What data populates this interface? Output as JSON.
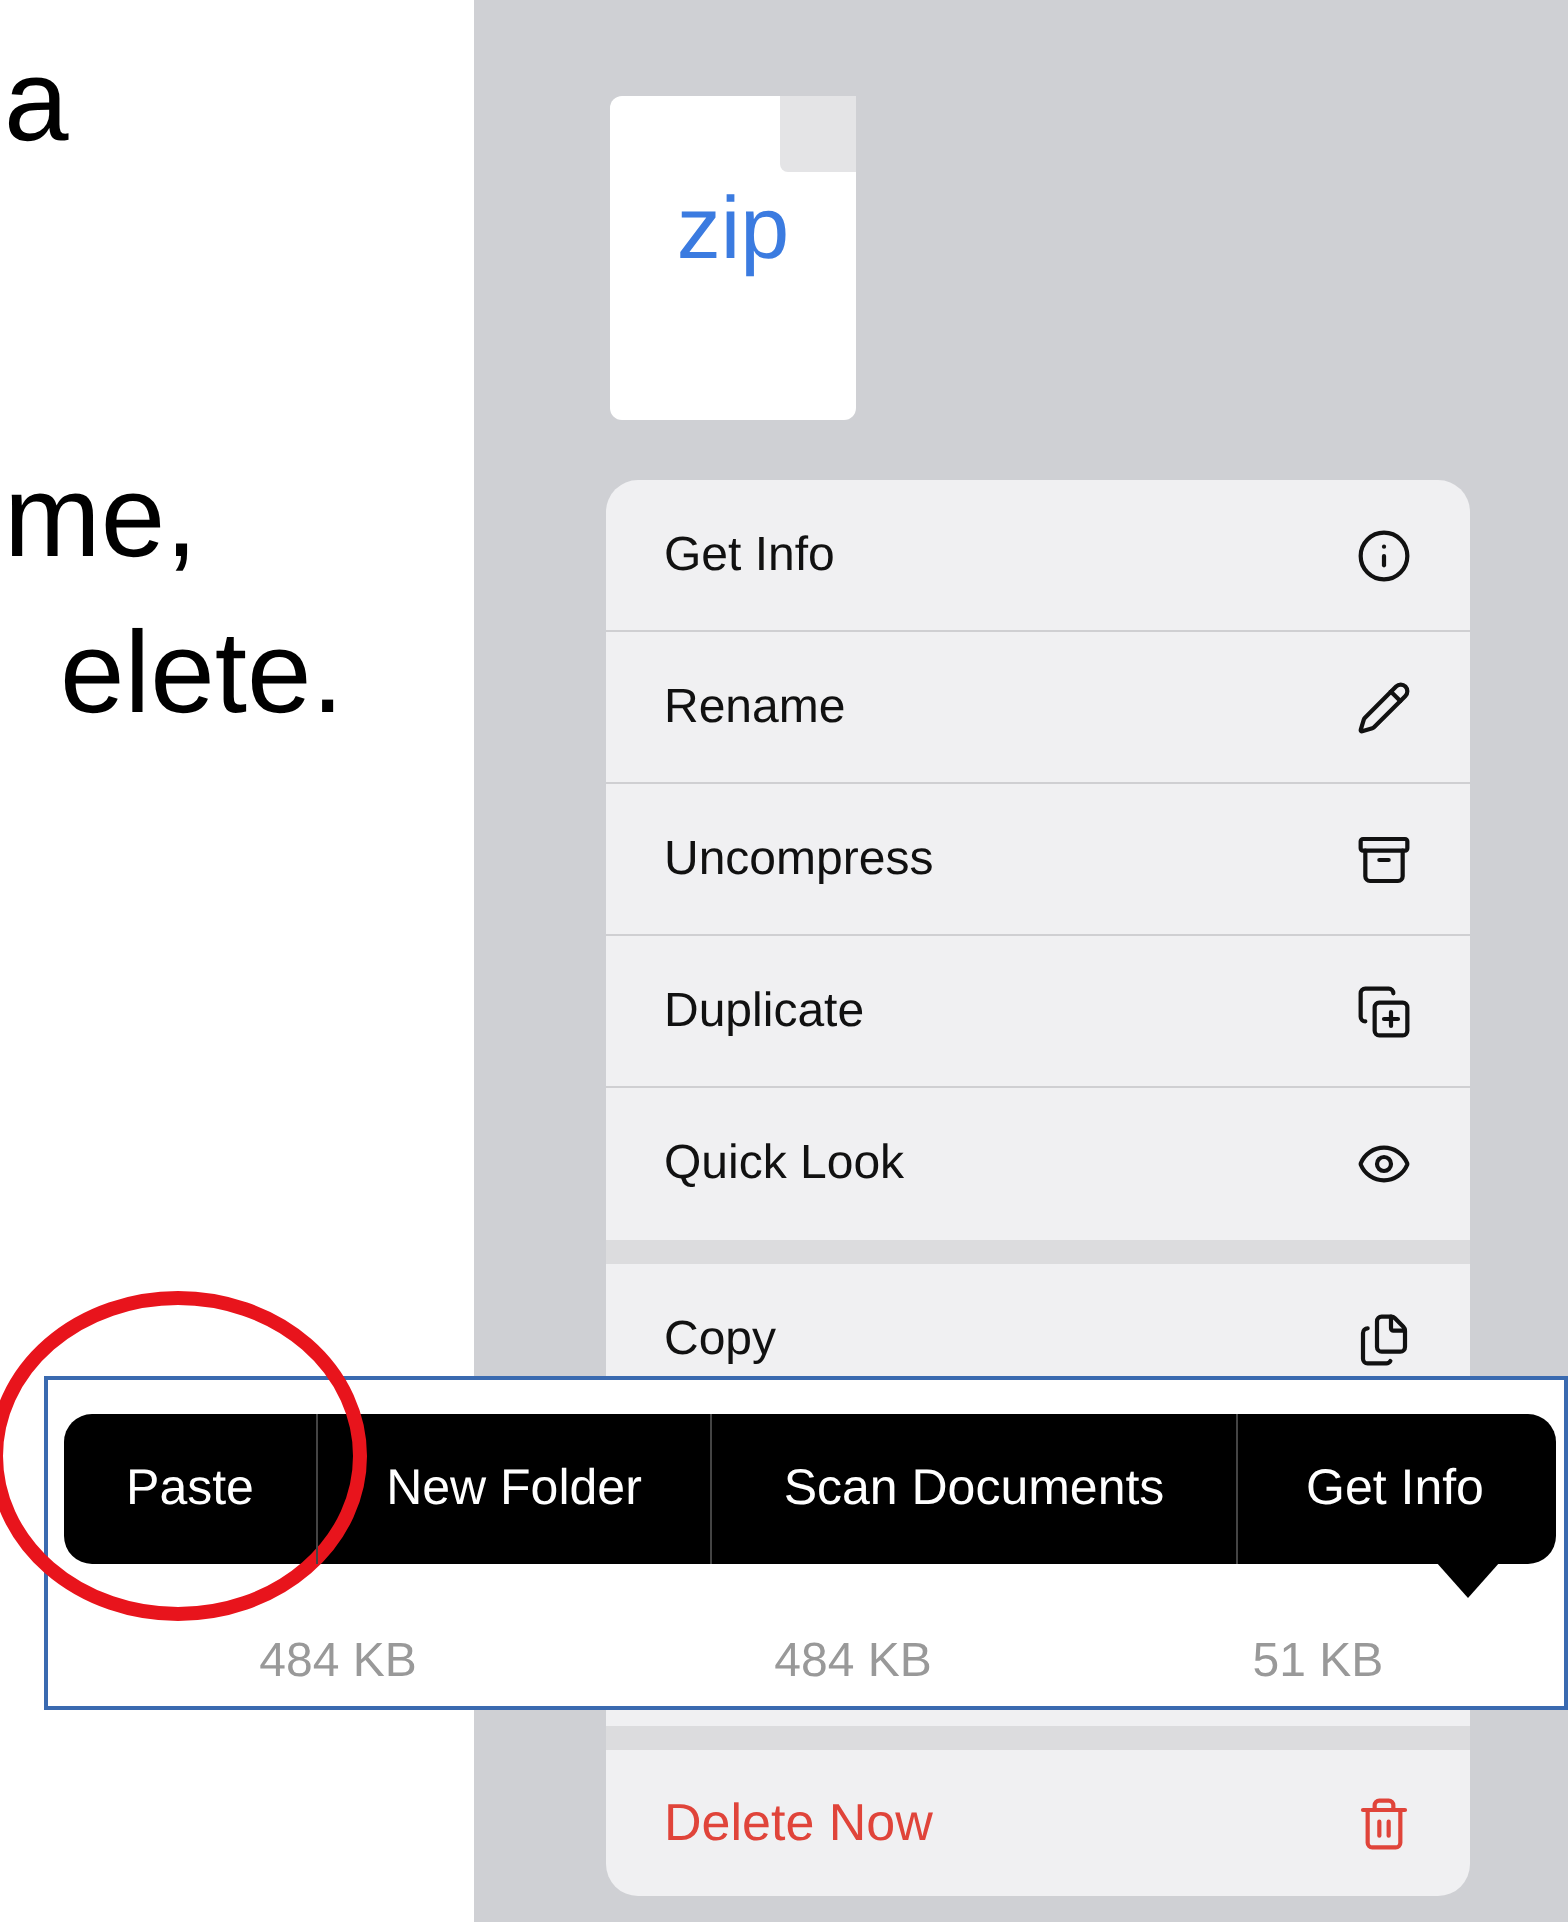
{
  "slide_text": [
    "a",
    "me,",
    "elete."
  ],
  "file": {
    "badge": "zip"
  },
  "context_menu": {
    "items": [
      {
        "label": "Get Info",
        "kind": "info"
      },
      {
        "label": "Rename",
        "kind": "rename"
      },
      {
        "label": "Uncompress",
        "kind": "archive"
      },
      {
        "label": "Duplicate",
        "kind": "duplicate"
      },
      {
        "label": "Quick Look",
        "kind": "look"
      },
      {
        "label": "Copy",
        "kind": "copy"
      }
    ],
    "delete_item": {
      "label": "Delete Now"
    }
  },
  "files_strip": {
    "files": [
      {
        "size": "484 KB"
      },
      {
        "size": "484 KB"
      },
      {
        "size": "51 KB"
      }
    ]
  },
  "edit_menu": {
    "items": [
      {
        "label": "Paste",
        "circled": true
      },
      {
        "label": "New Folder",
        "circled": false
      },
      {
        "label": "Scan Documents",
        "circled": false
      },
      {
        "label": "Get Info",
        "circled": false
      }
    ]
  }
}
